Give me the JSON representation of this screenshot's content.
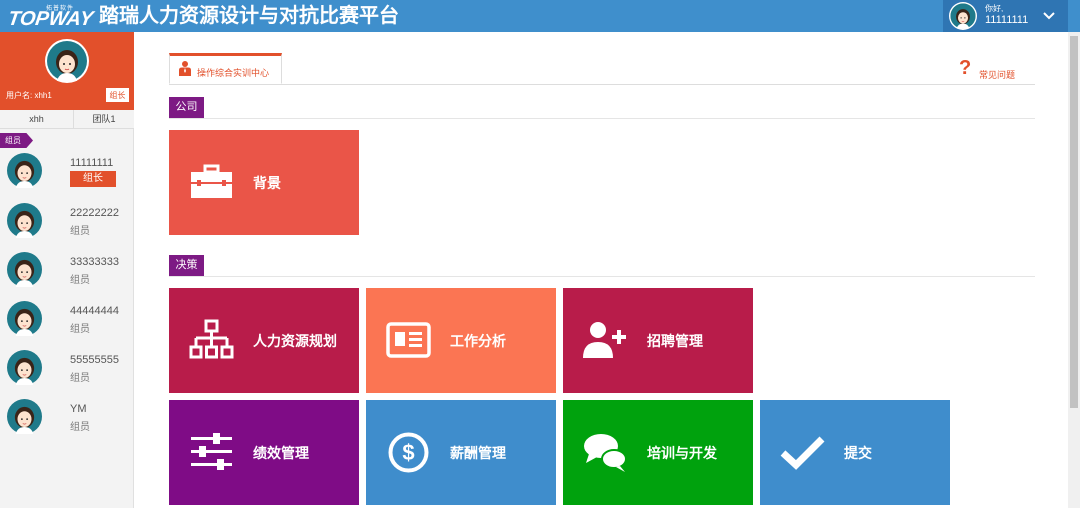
{
  "header": {
    "logo_small": "拓普软件",
    "logo_big": "TOPWAY",
    "title": "踏瑞人力资源设计与对抗比赛平台",
    "greeting": "你好,",
    "username": "11111111"
  },
  "sidebar": {
    "profile": {
      "username_label": "用户名: xhh1",
      "role": "组长"
    },
    "team_row": [
      "xhh",
      "团队1"
    ],
    "members_label": "组员",
    "members": [
      {
        "name": "11111111",
        "role": "组长"
      },
      {
        "name": "22222222",
        "role": "组员"
      },
      {
        "name": "33333333",
        "role": "组员"
      },
      {
        "name": "44444444",
        "role": "组员"
      },
      {
        "name": "55555555",
        "role": "组员"
      },
      {
        "name": "YM",
        "role": "组员"
      }
    ]
  },
  "main": {
    "tab_label": "操作综合实训中心",
    "faq_label": "常见问题",
    "sections": [
      {
        "label": "公司",
        "tiles": [
          {
            "label": "背景",
            "icon": "briefcase-icon",
            "color": "#ea5548"
          }
        ]
      },
      {
        "label": "决策",
        "tiles": [
          {
            "label": "人力资源规划",
            "icon": "org-chart-icon",
            "color": "#b81c4a"
          },
          {
            "label": "工作分析",
            "icon": "id-card-icon",
            "color": "#fb7553"
          },
          {
            "label": "招聘管理",
            "icon": "add-user-icon",
            "color": "#b81c4a"
          },
          {
            "label": "绩效管理",
            "icon": "sliders-icon",
            "color": "#7f0c86"
          },
          {
            "label": "薪酬管理",
            "icon": "dollar-icon",
            "color": "#3f8dcc"
          },
          {
            "label": "培训与开发",
            "icon": "chat-bubbles-icon",
            "color": "#00a20d"
          },
          {
            "label": "提交",
            "icon": "checkmark-icon",
            "color": "#3f8dcc"
          }
        ]
      }
    ]
  },
  "colors": {
    "header": "#3f8fcc",
    "profile": "#e2502b",
    "section_tag": "#7d1a84"
  }
}
